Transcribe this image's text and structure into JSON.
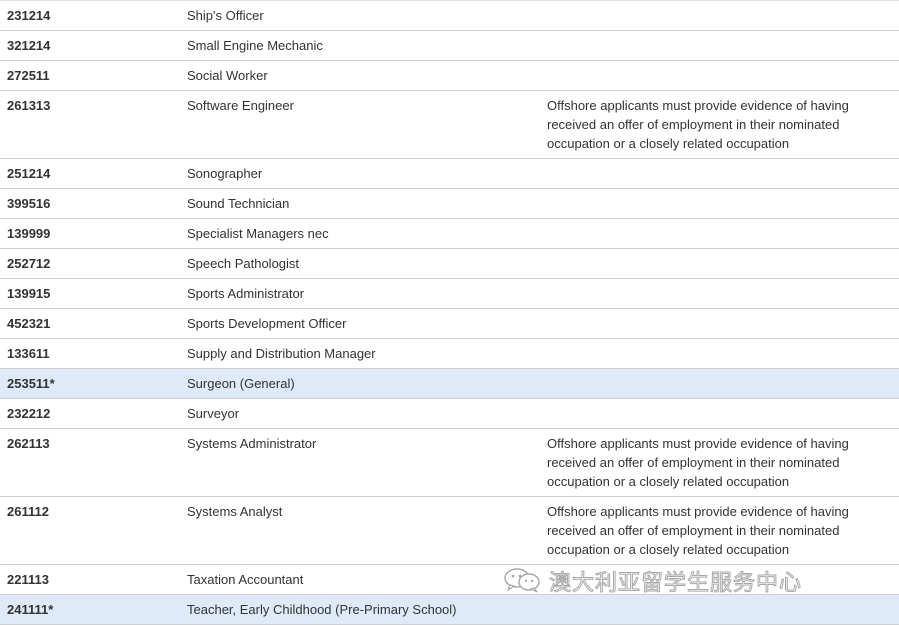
{
  "rows": [
    {
      "code": "231214",
      "occupation": "Ship's Officer",
      "note": "",
      "highlight": false
    },
    {
      "code": "321214",
      "occupation": "Small Engine Mechanic",
      "note": "",
      "highlight": false
    },
    {
      "code": "272511",
      "occupation": "Social Worker",
      "note": "",
      "highlight": false
    },
    {
      "code": "261313",
      "occupation": "Software Engineer",
      "note": "Offshore applicants must provide evidence of having\nreceived an offer of employment in their nominated\noccupation or a closely related occupation",
      "highlight": false
    },
    {
      "code": "251214",
      "occupation": "Sonographer",
      "note": "",
      "highlight": false
    },
    {
      "code": "399516",
      "occupation": "Sound Technician",
      "note": "",
      "highlight": false
    },
    {
      "code": "139999",
      "occupation": "Specialist Managers nec",
      "note": "",
      "highlight": false
    },
    {
      "code": "252712",
      "occupation": "Speech Pathologist",
      "note": "",
      "highlight": false
    },
    {
      "code": "139915",
      "occupation": "Sports Administrator",
      "note": "",
      "highlight": false
    },
    {
      "code": "452321",
      "occupation": "Sports Development Officer",
      "note": "",
      "highlight": false
    },
    {
      "code": "133611",
      "occupation": "Supply and Distribution Manager",
      "note": "",
      "highlight": false
    },
    {
      "code": "253511*",
      "occupation": "Surgeon (General)",
      "note": "",
      "highlight": true
    },
    {
      "code": "232212",
      "occupation": "Surveyor",
      "note": "",
      "highlight": false
    },
    {
      "code": "262113",
      "occupation": "Systems Administrator",
      "note": "Offshore applicants must  provide evidence of having\nreceived an offer of employment in their nominated\noccupation or a closely related occupation",
      "highlight": false
    },
    {
      "code": "261112",
      "occupation": "Systems Analyst",
      "note": "Offshore applicants must  provide evidence of having\nreceived an offer of employment in their nominated\noccupation or a closely related occupation",
      "highlight": false
    },
    {
      "code": "221113",
      "occupation": "Taxation Accountant",
      "note": "",
      "highlight": false
    },
    {
      "code": "241111*",
      "occupation": "Teacher, Early Childhood (Pre-Primary School)",
      "note": "",
      "highlight": true
    }
  ],
  "watermark": {
    "icon": "wechat-icon",
    "text": "澳大利亚留学生服务中心"
  },
  "colors": {
    "highlight_row": "#deeaf8",
    "border": "#cfcfcf",
    "text": "#333333"
  }
}
